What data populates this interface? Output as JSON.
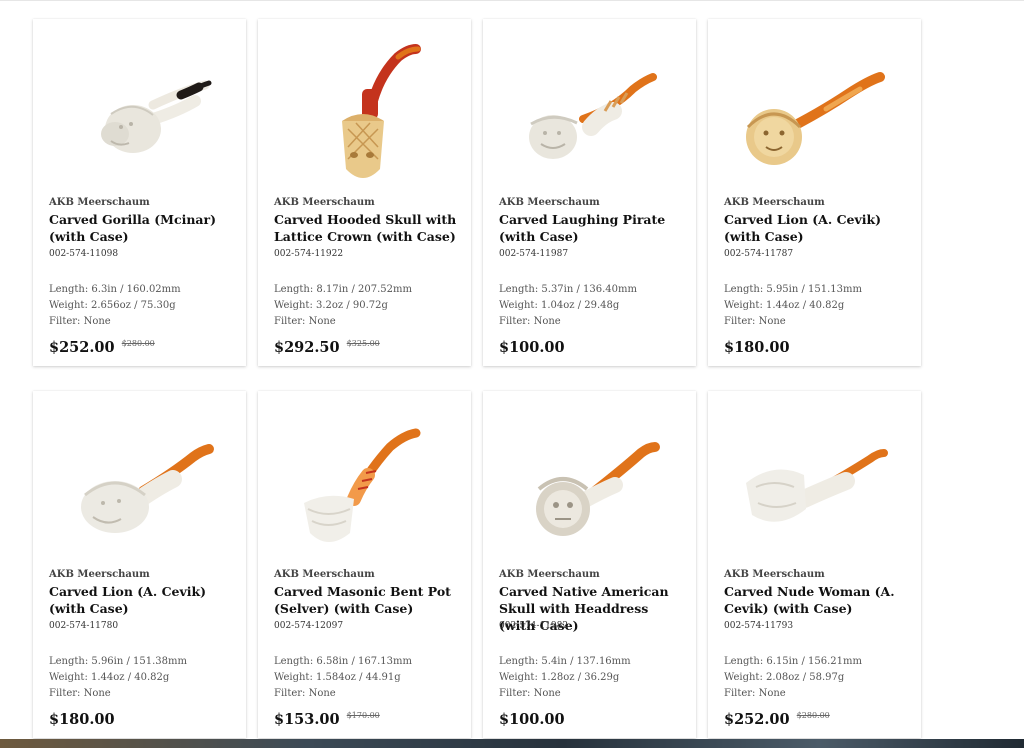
{
  "products": [
    {
      "brand": "AKB Meerschaum",
      "title": "Carved Gorilla (Mcinar) (with Case)",
      "sku": "002-574-11098",
      "length": "Length: 6.3in / 160.02mm",
      "weight": "Weight: 2.656oz / 75.30g",
      "filter": "Filter: None",
      "price": "$252.00",
      "old_price": "$280.00",
      "pipe": {
        "head": "gorilla-carving",
        "stem": "black"
      }
    },
    {
      "brand": "AKB Meerschaum",
      "title": "Carved Hooded Skull with Lattice Crown (with Case)",
      "sku": "002-574-11922",
      "length": "Length: 8.17in / 207.52mm",
      "weight": "Weight: 3.2oz / 90.72g",
      "filter": "Filter: None",
      "price": "$292.50",
      "old_price": "$325.00",
      "pipe": {
        "head": "hooded-skull-carving",
        "stem": "red-amber"
      }
    },
    {
      "brand": "AKB Meerschaum",
      "title": "Carved Laughing Pirate (with Case)",
      "sku": "002-574-11987",
      "length": "Length: 5.37in / 136.40mm",
      "weight": "Weight: 1.04oz / 29.48g",
      "filter": "Filter: None",
      "price": "$100.00",
      "old_price": "",
      "pipe": {
        "head": "pirate-carving",
        "stem": "amber"
      }
    },
    {
      "brand": "AKB Meerschaum",
      "title": "Carved Lion (A. Cevik) (with Case)",
      "sku": "002-574-11787",
      "length": "Length: 5.95in / 151.13mm",
      "weight": "Weight: 1.44oz / 40.82g",
      "filter": "Filter: None",
      "price": "$180.00",
      "old_price": "",
      "pipe": {
        "head": "lion-carving",
        "stem": "amber"
      }
    },
    {
      "brand": "AKB Meerschaum",
      "title": "Carved Lion (A. Cevik) (with Case)",
      "sku": "002-574-11780",
      "length": "Length: 5.96in / 151.38mm",
      "weight": "Weight: 1.44oz / 40.82g",
      "filter": "Filter: None",
      "price": "$180.00",
      "old_price": "",
      "pipe": {
        "head": "lion-carving",
        "stem": "amber"
      }
    },
    {
      "brand": "AKB Meerschaum",
      "title": "Carved Masonic Bent Pot (Selver) (with Case)",
      "sku": "002-574-12097",
      "length": "Length: 6.58in / 167.13mm",
      "weight": "Weight: 1.584oz / 44.91g",
      "filter": "Filter: None",
      "price": "$153.00",
      "old_price": "$170.00",
      "pipe": {
        "head": "bent-pot-carving",
        "stem": "amber"
      }
    },
    {
      "brand": "AKB Meerschaum",
      "title": "Carved Native American Skull with Headdress (with Case)",
      "sku": "002-574-11982",
      "length": "Length: 5.4in / 137.16mm",
      "weight": "Weight: 1.28oz / 36.29g",
      "filter": "Filter: None",
      "price": "$100.00",
      "old_price": "",
      "pipe": {
        "head": "skull-headdress-carving",
        "stem": "amber"
      }
    },
    {
      "brand": "AKB Meerschaum",
      "title": "Carved Nude Woman (A. Cevik) (with Case)",
      "sku": "002-574-11793",
      "length": "Length: 6.15in / 156.21mm",
      "weight": "Weight: 2.08oz / 58.97g",
      "filter": "Filter: None",
      "price": "$252.00",
      "old_price": "$280.00",
      "pipe": {
        "head": "nude-woman-carving",
        "stem": "amber"
      }
    }
  ],
  "colors": {
    "meerschaum_white": "#efece4",
    "meerschaum_tan": "#e9c98a",
    "amber_stem": "#e0731a",
    "red_stem": "#c4331d",
    "black_stem": "#1f1a17"
  }
}
